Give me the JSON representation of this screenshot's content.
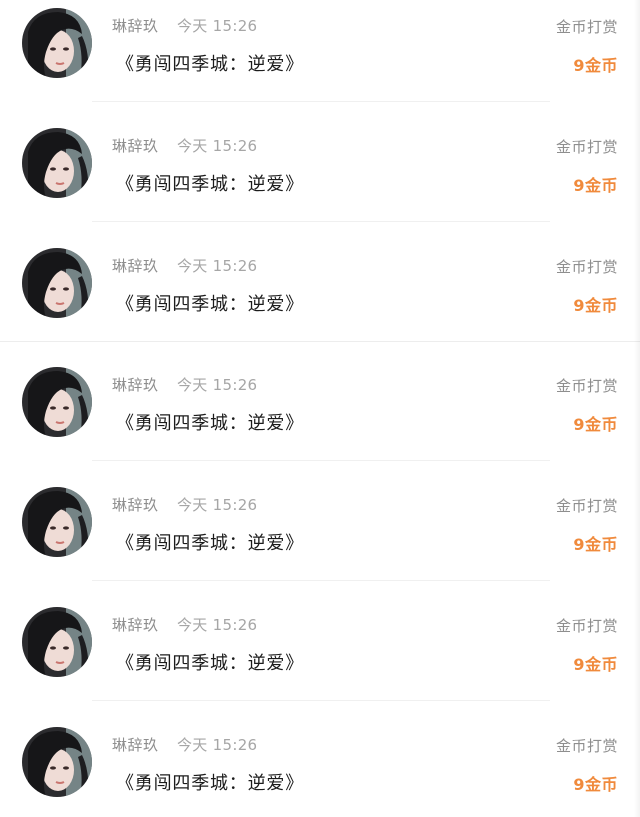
{
  "notifications": [
    {
      "username": "琳辞玖",
      "time": "今天 15:26",
      "title": "《勇闯四季城：逆爱》",
      "reward_label": "金币打赏",
      "amount": "9金币"
    },
    {
      "username": "琳辞玖",
      "time": "今天 15:26",
      "title": "《勇闯四季城：逆爱》",
      "reward_label": "金币打赏",
      "amount": "9金币"
    },
    {
      "username": "琳辞玖",
      "time": "今天 15:26",
      "title": "《勇闯四季城：逆爱》",
      "reward_label": "金币打赏",
      "amount": "9金币"
    },
    {
      "username": "琳辞玖",
      "time": "今天 15:26",
      "title": "《勇闯四季城：逆爱》",
      "reward_label": "金币打赏",
      "amount": "9金币"
    },
    {
      "username": "琳辞玖",
      "time": "今天 15:26",
      "title": "《勇闯四季城：逆爱》",
      "reward_label": "金币打赏",
      "amount": "9金币"
    },
    {
      "username": "琳辞玖",
      "time": "今天 15:26",
      "title": "《勇闯四季城：逆爱》",
      "reward_label": "金币打赏",
      "amount": "9金币"
    },
    {
      "username": "琳辞玖",
      "time": "今天 15:26",
      "title": "《勇闯四季城：逆爱》",
      "reward_label": "金币打赏",
      "amount": "9金币"
    }
  ],
  "colors": {
    "amount_accent": "#f08a3c",
    "meta_text": "#8e8e8e",
    "title_text": "#1c1c1c"
  },
  "icons": {
    "avatar": "user-avatar-photo"
  }
}
